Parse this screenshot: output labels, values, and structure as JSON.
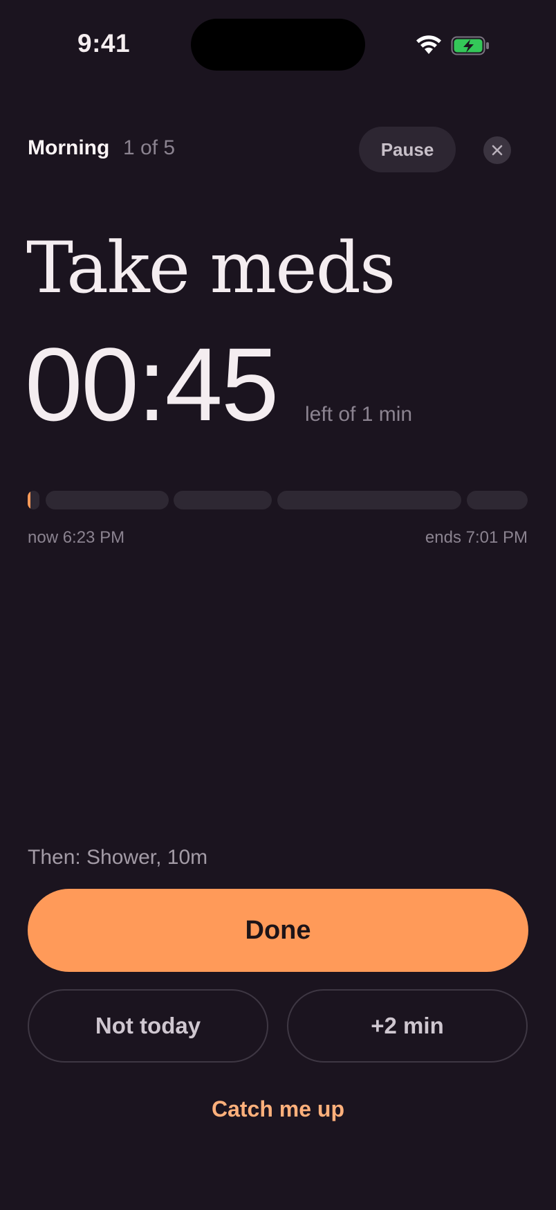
{
  "status_bar": {
    "time": "9:41",
    "icons": [
      "wifi-icon",
      "battery-charging-icon"
    ]
  },
  "header": {
    "routine_name": "Morning",
    "step_indicator": "1 of 5",
    "pause_label": "Pause",
    "close_icon": "close-icon"
  },
  "task": {
    "title": "Take meds",
    "countdown": "00:45",
    "duration_label": "left of 1 min"
  },
  "progress": {
    "segments": [
      {
        "index": 1,
        "fill_fraction": 0.25
      },
      {
        "index": 2,
        "fill_fraction": 0
      },
      {
        "index": 3,
        "fill_fraction": 0
      },
      {
        "index": 4,
        "fill_fraction": 0
      },
      {
        "index": 5,
        "fill_fraction": 0
      }
    ],
    "now_label": "now 6:23 PM",
    "ends_label": "ends 7:01 PM"
  },
  "next": {
    "label": "Then: Shower, 10m"
  },
  "actions": {
    "done_label": "Done",
    "skip_label": "Not today",
    "extend_label": "+2 min",
    "catch_up_label": "Catch me up"
  },
  "colors": {
    "background": "#1b141f",
    "accent": "#ff9a59",
    "accent_text": "#ffb07b",
    "muted_text": "#8b8390",
    "segment_track": "#2e2833"
  }
}
